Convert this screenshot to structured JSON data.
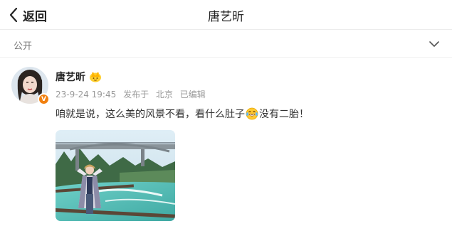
{
  "header": {
    "back_label": "返回",
    "title": "唐艺昕"
  },
  "filter": {
    "label": "公开"
  },
  "post": {
    "author": "唐艺昕",
    "verified_badge": "V",
    "meta": {
      "timestamp": "23-9-24 19:45",
      "location_prefix": "发布于",
      "location": "北京",
      "edited": "已编辑"
    },
    "text_before_emoji": "咱就是说，这么美的风景不看，看什么肚子",
    "emoji": "laughing-tears-emoji",
    "text_after_emoji": "没有二胎！"
  },
  "colors": {
    "accent_orange": "#f1800f",
    "meta_gray": "#999999",
    "text": "#333333"
  }
}
